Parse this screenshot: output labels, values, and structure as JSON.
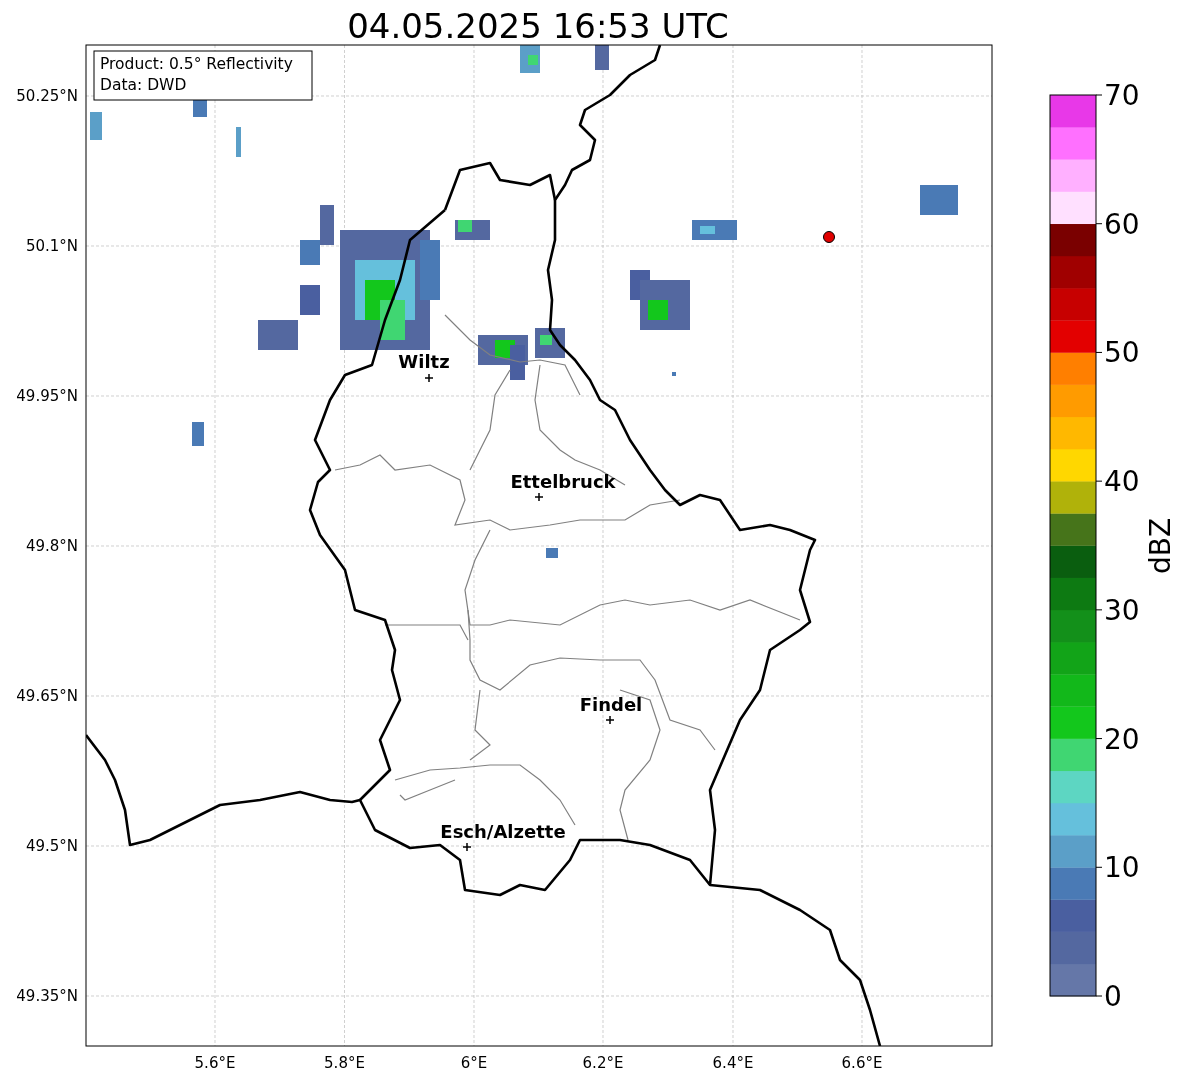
{
  "title": "04.05.2025 16:53 UTC",
  "info_box": [
    "Product: 0.5° Reflectivity",
    "Data: DWD"
  ],
  "x_ticks": [
    "5.6°E",
    "5.8°E",
    "6°E",
    "6.2°E",
    "6.4°E",
    "6.6°E"
  ],
  "y_ticks": [
    "50.25°N",
    "50.1°N",
    "49.95°N",
    "49.8°N",
    "49.65°N",
    "49.5°N",
    "49.35°N"
  ],
  "cities": [
    {
      "name": "Wiltz"
    },
    {
      "name": "Ettelbruck"
    },
    {
      "name": "Findel"
    },
    {
      "name": "Esch/Alzette"
    }
  ],
  "colorbar": {
    "label": "dBZ",
    "ticks": [
      "70",
      "60",
      "50",
      "40",
      "30",
      "20",
      "10",
      "0"
    ],
    "bands": [
      {
        "color": "#6577a8"
      },
      {
        "color": "#5468a0"
      },
      {
        "color": "#4a5fa0"
      },
      {
        "color": "#4a7ab5"
      },
      {
        "color": "#5b9fc8"
      },
      {
        "color": "#65c0dc"
      },
      {
        "color": "#5dd6c2"
      },
      {
        "color": "#40d672"
      },
      {
        "color": "#13c71c"
      },
      {
        "color": "#12b81a"
      },
      {
        "color": "#12a418"
      },
      {
        "color": "#13901a"
      },
      {
        "color": "#0d7a12"
      },
      {
        "color": "#0a5e0f"
      },
      {
        "color": "#46741a"
      },
      {
        "color": "#b0b20a"
      },
      {
        "color": "#ffd700"
      },
      {
        "color": "#ffb800"
      },
      {
        "color": "#ff9b00"
      },
      {
        "color": "#ff7f00"
      },
      {
        "color": "#e30000"
      },
      {
        "color": "#c70000"
      },
      {
        "color": "#a00000"
      },
      {
        "color": "#7a0000"
      },
      {
        "color": "#ffe0ff"
      },
      {
        "color": "#ffb0ff"
      },
      {
        "color": "#ff70ff"
      },
      {
        "color": "#e838e8"
      }
    ]
  }
}
